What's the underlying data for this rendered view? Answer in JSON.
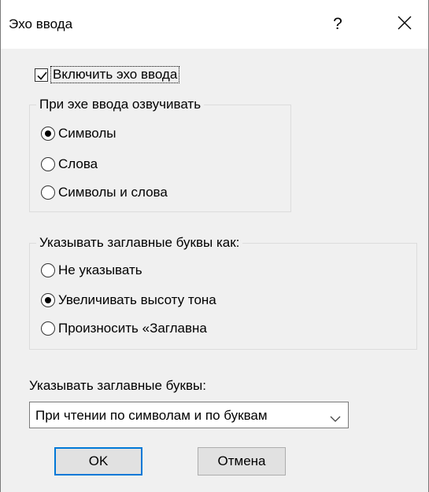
{
  "dialog": {
    "title": "Эхо ввода",
    "help_symbol": "?",
    "close_icon": "close-icon",
    "echo_checkbox": {
      "label": "Включить эхо ввода",
      "checked": true
    },
    "speak_group": {
      "legend": "При эхе ввода озвучивать",
      "options": [
        {
          "label": "Символы",
          "selected": true
        },
        {
          "label": "Слова",
          "selected": false
        },
        {
          "label": "Символы и слова",
          "selected": false
        }
      ]
    },
    "capitals_group": {
      "legend": "Указывать заглавные буквы как:",
      "options": [
        {
          "label": "Не указывать",
          "selected": false
        },
        {
          "label": "Увеличивать высоту тона",
          "selected": true
        },
        {
          "label": "Произносить «Заглавна",
          "selected": false
        }
      ]
    },
    "capitals_when": {
      "label": "Указывать заглавные буквы:",
      "selected_value": "При чтении по символам и по буквам",
      "arrow_icon": "chevron-down-icon"
    },
    "buttons": {
      "ok": "OK",
      "cancel": "Отмена"
    },
    "colors": {
      "accent": "#0078d7",
      "background": "#f0f0f0",
      "titlebar": "#ffffff"
    }
  }
}
